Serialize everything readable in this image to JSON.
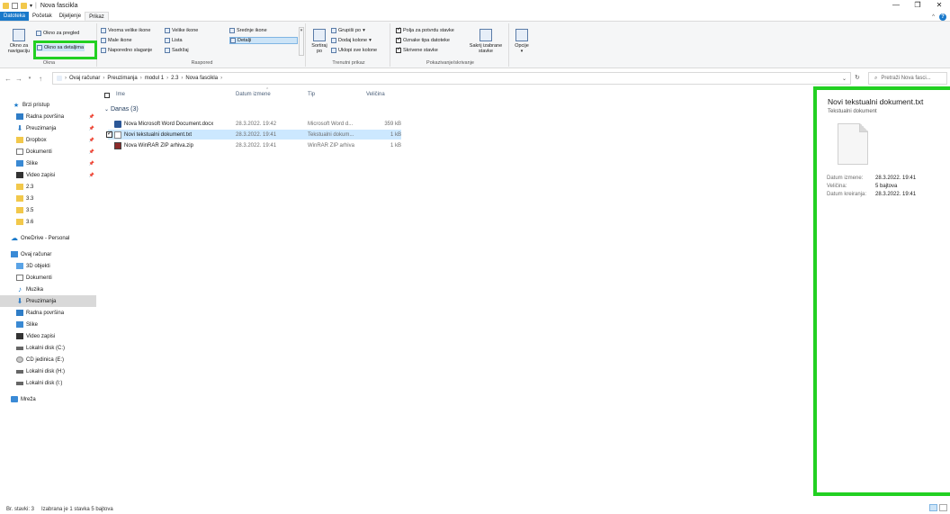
{
  "window": {
    "title": "Nova fascikla",
    "controls": {
      "minimize": "—",
      "restore": "❐",
      "close": "✕"
    }
  },
  "ribbon_tabs": [
    "Datoteka",
    "Početak",
    "Dijeljenje",
    "Prikaz"
  ],
  "ribbon": {
    "okna": {
      "label": "Okna",
      "nav_pane": "Okno za navigaciju",
      "preview_pane": "Okno za pregled",
      "details_pane": "Okno sa detaljima"
    },
    "raspored": {
      "label": "Raspored",
      "items": [
        "Veoma velike ikone",
        "Velike ikone",
        "Srednje ikone",
        "Male ikone",
        "Lista",
        "Detalji",
        "Naporedno slaganje",
        "Sadržaj"
      ]
    },
    "trenutni": {
      "label": "Trenutni prikaz",
      "sort": "Sortiraj po",
      "group": "Grupiši po",
      "add_cols": "Dodaj kolone",
      "fit_cols": "Uklopi sve kolone"
    },
    "pokazi": {
      "label": "Pokazivanje/skrivanje",
      "checkboxes": "Polja za potvrdu stavke",
      "extensions": "Oznake tipa datoteke",
      "hidden": "Skrivene stavke",
      "hide_selected": "Sakrij izabrane stavke"
    },
    "options": "Opcije"
  },
  "address": {
    "path": [
      "Ovaj računar",
      "Preuzimanja",
      "modul 1",
      "2.3",
      "Nova fascikla"
    ],
    "search_placeholder": "Pretraži Nova fasci..."
  },
  "nav": [
    {
      "label": "Brzi pristup",
      "icon": "star-icon"
    },
    {
      "label": "Radna površina",
      "icon": "desktop-icon",
      "pinned": true
    },
    {
      "label": "Preuzimanja",
      "icon": "download-icon",
      "pinned": true
    },
    {
      "label": "Dropbox",
      "icon": "dropbox-icon",
      "pinned": true
    },
    {
      "label": "Dokumenti",
      "icon": "documents-icon",
      "pinned": true
    },
    {
      "label": "Slike",
      "icon": "pictures-icon",
      "pinned": true
    },
    {
      "label": "Video zapisi",
      "icon": "video-icon",
      "pinned": true
    },
    {
      "label": "2.3",
      "icon": "folder-icon"
    },
    {
      "label": "3.3",
      "icon": "folder-icon"
    },
    {
      "label": "3.5",
      "icon": "folder-icon"
    },
    {
      "label": "3.6",
      "icon": "folder-icon"
    },
    {
      "label": "OneDrive - Personal",
      "icon": "cloud-icon"
    },
    {
      "label": "Ovaj računar",
      "icon": "computer-icon"
    },
    {
      "label": "3D objekti",
      "icon": "3d-objects-icon"
    },
    {
      "label": "Dokumenti",
      "icon": "documents-icon"
    },
    {
      "label": "Muzika",
      "icon": "music-icon"
    },
    {
      "label": "Preuzimanja",
      "icon": "download-icon",
      "selected": true
    },
    {
      "label": "Radna površina",
      "icon": "desktop-icon"
    },
    {
      "label": "Slike",
      "icon": "pictures-icon"
    },
    {
      "label": "Video zapisi",
      "icon": "video-icon"
    },
    {
      "label": "Lokalni disk (C:)",
      "icon": "disk-icon"
    },
    {
      "label": "CD jedinica (E:)",
      "icon": "cd-icon"
    },
    {
      "label": "Lokalni disk (H:)",
      "icon": "disk-icon"
    },
    {
      "label": "Lokalni disk (I:)",
      "icon": "disk-icon"
    },
    {
      "label": "Mreža",
      "icon": "network-icon"
    }
  ],
  "columns": {
    "name": "Ime",
    "date": "Datum izmene",
    "type": "Tip",
    "size": "Veličina"
  },
  "group_title": "Danas (3)",
  "files": [
    {
      "name": "Nova Microsoft Word Document.docx",
      "date": "28.3.2022. 19:42",
      "type": "Microsoft Word d...",
      "size": "359 kB",
      "icon": "word-icon"
    },
    {
      "name": "Novi tekstualni dokument.txt",
      "date": "28.3.2022. 19:41",
      "type": "Tekstualni dokum...",
      "size": "1 kB",
      "icon": "text-file-icon",
      "selected": true
    },
    {
      "name": "Nova WinRAR ZIP arhiva.zip",
      "date": "28.3.2022. 19:41",
      "type": "WinRAR ZIP arhiva",
      "size": "1 kB",
      "icon": "zip-icon"
    }
  ],
  "details_pane": {
    "title": "Novi tekstualni dokument.txt",
    "subtitle": "Tekstualni dokument",
    "props": [
      {
        "key": "Datum izmene:",
        "value": "28.3.2022. 19:41"
      },
      {
        "key": "Veličina:",
        "value": "5 bajtova"
      },
      {
        "key": "Datum kreiranja:",
        "value": "28.3.2022. 19:41"
      }
    ]
  },
  "status": {
    "count": "Br. stavki: 3",
    "selection": "Izabrana je 1 stavka  5 bajtova"
  },
  "colors": {
    "accent": "#1979ca",
    "highlight": "#22d022",
    "selection": "#cce8ff"
  }
}
